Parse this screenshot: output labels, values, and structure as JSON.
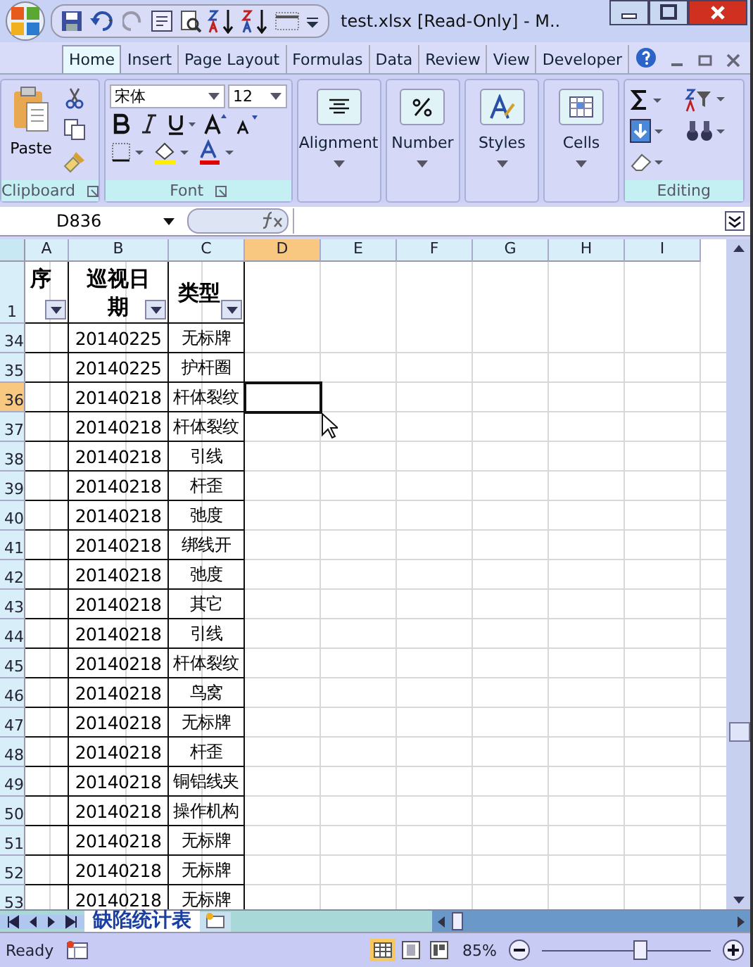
{
  "window": {
    "title": "test.xlsx  [Read-Only] - M.."
  },
  "tabs": [
    {
      "label": "Home",
      "selected": true
    },
    {
      "label": "Insert",
      "selected": false
    },
    {
      "label": "Page Layout",
      "selected": false
    },
    {
      "label": "Formulas",
      "selected": false
    },
    {
      "label": "Data",
      "selected": false
    },
    {
      "label": "Review",
      "selected": false
    },
    {
      "label": "View",
      "selected": false
    },
    {
      "label": "Developer",
      "selected": false
    }
  ],
  "ribbon": {
    "clipboard": {
      "paste": "Paste",
      "label": "Clipboard"
    },
    "font": {
      "font_name": "宋体",
      "font_size": "12",
      "label": "Font"
    },
    "collapsed_groups": [
      {
        "kind": "alignment",
        "label": "Alignment"
      },
      {
        "kind": "number",
        "label": "Number"
      },
      {
        "kind": "styles",
        "label": "Styles"
      },
      {
        "kind": "cells",
        "label": "Cells"
      }
    ],
    "editing": {
      "label": "Editing"
    }
  },
  "formula_bar": {
    "name_box": "D836"
  },
  "sheet": {
    "columns": [
      {
        "label": "A",
        "selected": false
      },
      {
        "label": "B",
        "selected": false
      },
      {
        "label": "C",
        "selected": false
      },
      {
        "label": "D",
        "selected": true
      },
      {
        "label": "E",
        "selected": false
      },
      {
        "label": "F",
        "selected": false
      },
      {
        "label": "G",
        "selected": false
      },
      {
        "label": "H",
        "selected": false
      },
      {
        "label": "I",
        "selected": false
      }
    ],
    "header_row": {
      "number": "1",
      "cells": [
        "序",
        "巡视日期",
        "类型"
      ]
    },
    "rows": [
      {
        "number": "34",
        "selected": false,
        "cells": [
          "",
          "20140225",
          "无标牌"
        ]
      },
      {
        "number": "35",
        "selected": false,
        "cells": [
          "",
          "20140225",
          "护杆圈"
        ]
      },
      {
        "number": "36",
        "selected": true,
        "cells": [
          "",
          "20140218",
          "杆体裂纹"
        ]
      },
      {
        "number": "37",
        "selected": false,
        "cells": [
          "",
          "20140218",
          "杆体裂纹"
        ]
      },
      {
        "number": "38",
        "selected": false,
        "cells": [
          "",
          "20140218",
          "引线"
        ]
      },
      {
        "number": "39",
        "selected": false,
        "cells": [
          "",
          "20140218",
          "杆歪"
        ]
      },
      {
        "number": "40",
        "selected": false,
        "cells": [
          "",
          "20140218",
          "弛度"
        ]
      },
      {
        "number": "41",
        "selected": false,
        "cells": [
          "",
          "20140218",
          "绑线开"
        ]
      },
      {
        "number": "42",
        "selected": false,
        "cells": [
          "",
          "20140218",
          "弛度"
        ]
      },
      {
        "number": "43",
        "selected": false,
        "cells": [
          "",
          "20140218",
          "其它"
        ]
      },
      {
        "number": "44",
        "selected": false,
        "cells": [
          "",
          "20140218",
          "引线"
        ]
      },
      {
        "number": "45",
        "selected": false,
        "cells": [
          "",
          "20140218",
          "杆体裂纹"
        ]
      },
      {
        "number": "46",
        "selected": false,
        "cells": [
          "",
          "20140218",
          "鸟窝"
        ]
      },
      {
        "number": "47",
        "selected": false,
        "cells": [
          "",
          "20140218",
          "无标牌"
        ]
      },
      {
        "number": "48",
        "selected": false,
        "cells": [
          "",
          "20140218",
          "杆歪"
        ]
      },
      {
        "number": "49",
        "selected": false,
        "cells": [
          "",
          "20140218",
          "铜铝线夹"
        ]
      },
      {
        "number": "50",
        "selected": false,
        "cells": [
          "",
          "20140218",
          "操作机构"
        ]
      },
      {
        "number": "51",
        "selected": false,
        "cells": [
          "",
          "20140218",
          "无标牌"
        ]
      },
      {
        "number": "52",
        "selected": false,
        "cells": [
          "",
          "20140218",
          "无标牌"
        ]
      },
      {
        "number": "53",
        "selected": false,
        "cells": [
          "",
          "20140218",
          "无标牌"
        ]
      }
    ]
  },
  "sheet_tabs": [
    {
      "label": "缺陷统计表",
      "selected": true
    }
  ],
  "status_bar": {
    "text": "Ready",
    "zoom": "85%",
    "zoom_slider": {
      "level": 0.58
    }
  }
}
